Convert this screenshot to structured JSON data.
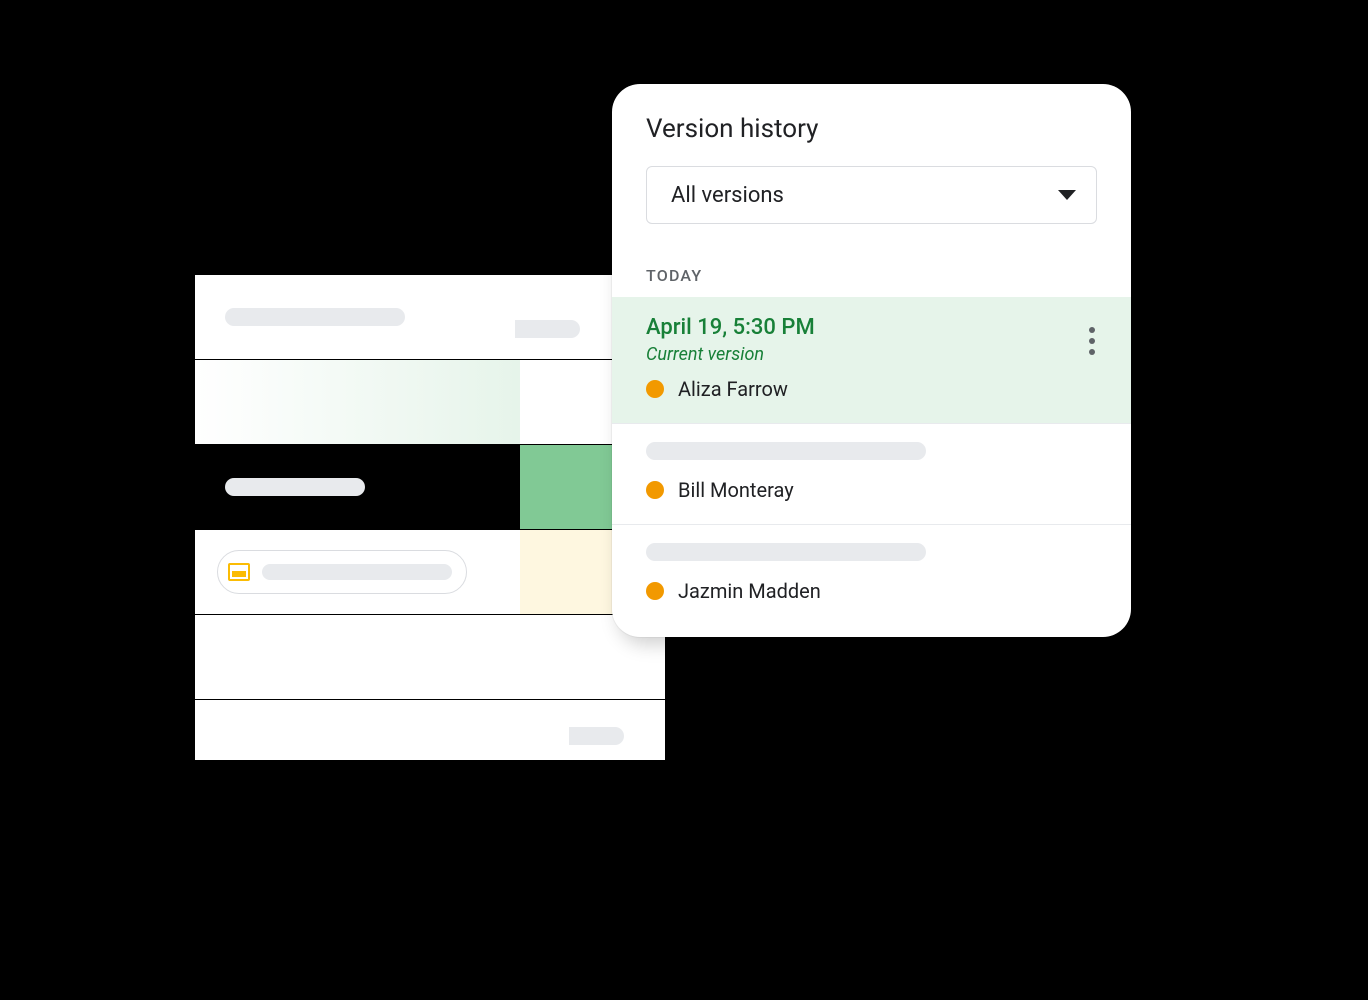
{
  "panel": {
    "title": "Version history",
    "dropdown": {
      "selected": "All versions"
    },
    "section_label": "TODAY",
    "versions": [
      {
        "date": "April 19, 5:30 PM",
        "subtitle": "Current version",
        "editor": "Aliza Farrow",
        "dot_color": "#f29900",
        "current": true
      },
      {
        "editor": "Bill Monteray",
        "dot_color": "#f29900",
        "current": false
      },
      {
        "editor": "Jazmin Madden",
        "dot_color": "#f29900",
        "current": false
      }
    ]
  }
}
